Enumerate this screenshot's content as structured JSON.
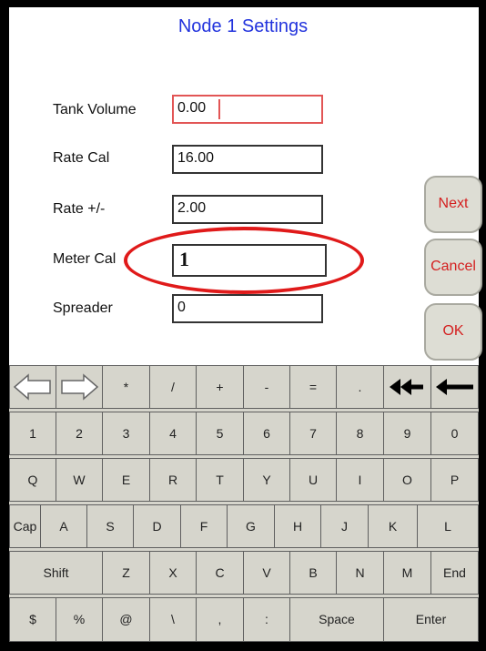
{
  "title": "Node 1 Settings",
  "fields": [
    {
      "label": "Tank Volume",
      "value": "0.00"
    },
    {
      "label": "Rate Cal",
      "value": "16.00"
    },
    {
      "label": "Rate +/-",
      "value": "2.00"
    },
    {
      "label": "Meter Cal",
      "value": "1"
    },
    {
      "label": "Spreader",
      "value": "0"
    }
  ],
  "buttons": {
    "next": "Next",
    "cancel": "Cancel",
    "ok": "OK"
  },
  "keyboard": {
    "row0": [
      "*",
      "/",
      "+",
      "-",
      "=",
      "."
    ],
    "row1": [
      "1",
      "2",
      "3",
      "4",
      "5",
      "6",
      "7",
      "8",
      "9",
      "0"
    ],
    "row2": [
      "Q",
      "W",
      "E",
      "R",
      "T",
      "Y",
      "U",
      "I",
      "O",
      "P"
    ],
    "row3": [
      "Cap",
      "A",
      "S",
      "D",
      "F",
      "G",
      "H",
      "J",
      "K",
      "L"
    ],
    "row4": [
      "Shift",
      "Z",
      "X",
      "C",
      "V",
      "B",
      "N",
      "M",
      "End"
    ],
    "row5": [
      "$",
      "%",
      "@",
      "\\",
      ",",
      ":",
      "Space",
      "Enter"
    ]
  },
  "icons": {
    "arrow_left": "hollow-left-arrow-icon",
    "arrow_right": "hollow-right-arrow-icon",
    "clear": "double-left-arrow-icon",
    "backspace": "left-arrow-icon"
  },
  "colors": {
    "title": "#2233dd",
    "button_text": "#d42020",
    "highlight": "#e01a1a",
    "keyboard": "#d6d5cc"
  }
}
